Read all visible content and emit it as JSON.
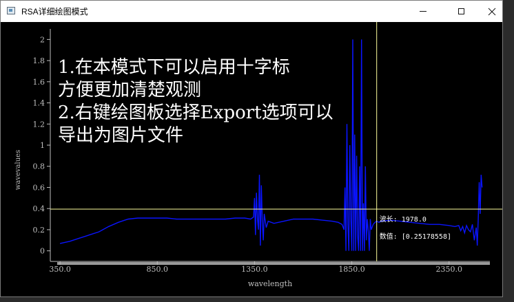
{
  "window": {
    "title": "RSA详细绘图模式",
    "controls": {
      "minimize": "minimize-icon",
      "maximize": "maximize-icon",
      "close": "close-icon"
    }
  },
  "overlay_text": [
    "1.在本模式下可以启用十字标",
    "方便更加清楚观测",
    "2.右键绘图板选择Export选项可以",
    "导出为图片文件"
  ],
  "crosshair": {
    "wavelength_label": "波长:",
    "wavelength_value": "1978.0",
    "value_label": "数值:",
    "value_value": "[0.25178558]",
    "x": 1978,
    "y": 0.395
  },
  "colors": {
    "background": "#000000",
    "series": "#0a14ff",
    "crosshair": "#ffff9e",
    "axis": "#bfbfbf"
  },
  "chart_data": {
    "type": "line",
    "xlabel": "wavelength",
    "ylabel": "wavevalues",
    "xlim": [
      300,
      2560
    ],
    "ylim": [
      -0.1,
      2.1
    ],
    "xticks": [
      "350.0",
      "850.0",
      "1350.0",
      "1850.0",
      "2350.0"
    ],
    "xtick_values": [
      350,
      850,
      1350,
      1850,
      2350
    ],
    "yticks": [
      "0",
      "0.2",
      "0.4",
      "0.6",
      "0.8",
      "1",
      "1.2",
      "1.4",
      "1.6",
      "1.8",
      "2"
    ],
    "ytick_values": [
      0,
      0.2,
      0.4,
      0.6,
      0.8,
      1.0,
      1.2,
      1.4,
      1.6,
      1.8,
      2.0
    ],
    "series": [
      {
        "x": [
          350,
          400,
          450,
          500,
          550,
          600,
          650,
          700,
          750,
          800,
          850,
          900,
          950,
          1000,
          1050,
          1100,
          1150,
          1200,
          1250,
          1300,
          1330,
          1345,
          1350,
          1355,
          1360,
          1365,
          1370,
          1375,
          1380,
          1385,
          1390,
          1395,
          1400,
          1410,
          1420,
          1450,
          1500,
          1550,
          1600,
          1650,
          1700,
          1750,
          1780,
          1800,
          1810,
          1815,
          1820,
          1825,
          1830,
          1835,
          1840,
          1845,
          1850,
          1855,
          1860,
          1865,
          1870,
          1875,
          1880,
          1885,
          1890,
          1895,
          1900,
          1905,
          1910,
          1915,
          1920,
          1925,
          1930,
          1935,
          1940,
          1945,
          1950,
          1960,
          1970,
          1978,
          1990,
          2000,
          2050,
          2100,
          2150,
          2200,
          2250,
          2300,
          2350,
          2380,
          2400,
          2410,
          2420,
          2430,
          2440,
          2450,
          2460,
          2470,
          2480,
          2490,
          2495,
          2500,
          2505,
          2510,
          2515,
          2520
        ],
        "y": [
          0.07,
          0.09,
          0.12,
          0.15,
          0.18,
          0.23,
          0.27,
          0.3,
          0.31,
          0.31,
          0.31,
          0.31,
          0.3,
          0.3,
          0.3,
          0.3,
          0.3,
          0.3,
          0.31,
          0.31,
          0.3,
          0.32,
          0.5,
          0.15,
          0.55,
          0.3,
          0.2,
          0.72,
          0.05,
          0.62,
          0.28,
          0.1,
          0.35,
          0.22,
          0.28,
          0.26,
          0.28,
          0.3,
          0.3,
          0.3,
          0.29,
          0.28,
          0.27,
          0.25,
          0.2,
          0.6,
          0.0,
          1.2,
          0.25,
          0.0,
          1.0,
          0.3,
          0.0,
          2.0,
          0.0,
          1.1,
          0.0,
          0.9,
          0.15,
          0.0,
          0.8,
          0.0,
          2.0,
          0.0,
          0.45,
          0.0,
          0.8,
          0.1,
          0.3,
          0.18,
          0.0,
          0.3,
          0.2,
          0.25,
          0.27,
          0.28,
          0.27,
          0.28,
          0.29,
          0.28,
          0.27,
          0.26,
          0.25,
          0.25,
          0.24,
          0.23,
          0.24,
          0.19,
          0.23,
          0.17,
          0.24,
          0.2,
          0.18,
          0.25,
          0.1,
          0.22,
          0.05,
          0.3,
          0.65,
          0.35,
          0.72,
          0.6
        ]
      }
    ]
  }
}
